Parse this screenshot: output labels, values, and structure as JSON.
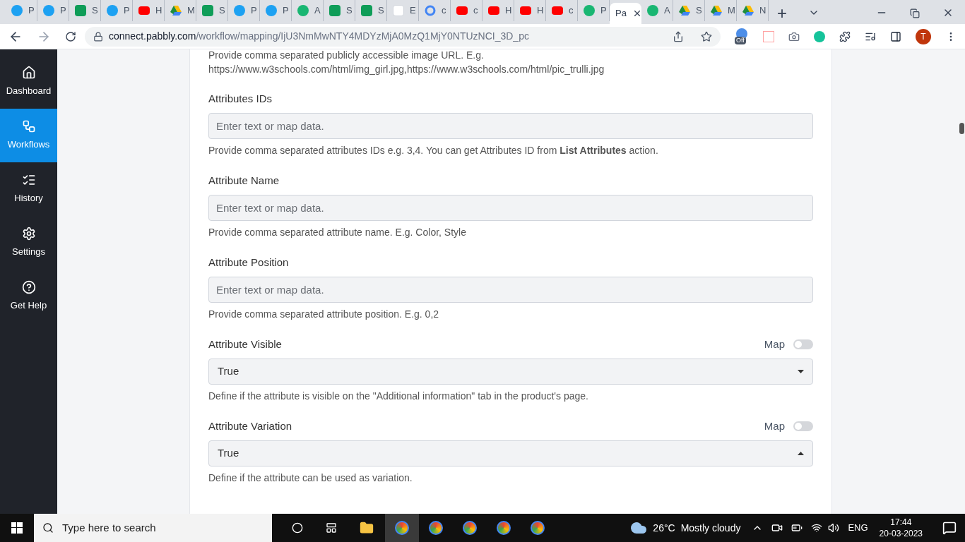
{
  "browser": {
    "tabs": [
      {
        "kind": "t",
        "label": "P",
        "selected": false
      },
      {
        "kind": "t",
        "label": "P",
        "selected": false
      },
      {
        "kind": "sheet",
        "label": "S",
        "selected": false
      },
      {
        "kind": "t",
        "label": "P",
        "selected": false
      },
      {
        "kind": "yt",
        "label": "H",
        "selected": false
      },
      {
        "kind": "drive",
        "label": "M",
        "selected": false
      },
      {
        "kind": "sheet",
        "label": "S",
        "selected": false
      },
      {
        "kind": "t",
        "label": "P",
        "selected": false
      },
      {
        "kind": "t",
        "label": "P",
        "selected": false
      },
      {
        "kind": "pabbly",
        "label": "A",
        "selected": false
      },
      {
        "kind": "sheet",
        "label": "S",
        "selected": false
      },
      {
        "kind": "sheet",
        "label": "S",
        "selected": false
      },
      {
        "kind": "amazon",
        "label": "E",
        "selected": false
      },
      {
        "kind": "google",
        "label": "c",
        "selected": false
      },
      {
        "kind": "yt",
        "label": "c",
        "selected": false
      },
      {
        "kind": "yt",
        "label": "H",
        "selected": false
      },
      {
        "kind": "yt",
        "label": "H",
        "selected": false
      },
      {
        "kind": "yt",
        "label": "c",
        "selected": false
      },
      {
        "kind": "pabbly",
        "label": "P",
        "selected": false
      },
      {
        "kind": "none",
        "label": "Pa",
        "selected": true
      },
      {
        "kind": "pabbly",
        "label": "A",
        "selected": false
      },
      {
        "kind": "drive",
        "label": "S",
        "selected": false
      },
      {
        "kind": "drive",
        "label": "M",
        "selected": false
      },
      {
        "kind": "drive",
        "label": "N",
        "selected": false
      }
    ],
    "new_tab": "+",
    "url_host": "connect.pabbly.com",
    "url_path": "/workflow/mapping/IjU3NmMwNTY4MDYzMjA0MzQ1MjY0NTUzNCI_3D_pc",
    "extension_badge": "Off",
    "profile": "T"
  },
  "sidebar": [
    {
      "kind": "home",
      "label": "Dashboard",
      "selected": false
    },
    {
      "kind": "flow",
      "label": "Workflows",
      "selected": true
    },
    {
      "kind": "list",
      "label": "History",
      "selected": false
    },
    {
      "kind": "gear",
      "label": "Settings",
      "selected": false
    },
    {
      "kind": "help",
      "label": "Get Help",
      "selected": false
    }
  ],
  "intro": [
    "Provide comma separated publicly accessible image URL. E.g.",
    "https://www.w3schools.com/html/img_girl.jpg,https://www.w3schools.com/html/pic_trulli.jpg"
  ],
  "fields": [
    {
      "kind": "text",
      "label": "Attributes IDs",
      "placeholder": "Enter text or map data.",
      "help": "Provide comma separated attributes IDs e.g. 3,4. You can get Attributes ID from **List Attributes** action."
    },
    {
      "kind": "text",
      "label": "Attribute Name",
      "placeholder": "Enter text or map data.",
      "help": "Provide comma separated attribute name. E.g. Color, Style"
    },
    {
      "kind": "text",
      "label": "Attribute Position",
      "placeholder": "Enter text or map data.",
      "help": "Provide comma separated attribute position. E.g. 0,2"
    },
    {
      "kind": "select",
      "label": "Attribute Visible",
      "map_label": "Map",
      "map_on": false,
      "value": "True",
      "expanded": false,
      "help": "Define if the attribute is visible on the \"Additional information\" tab in the product's page."
    },
    {
      "kind": "select",
      "label": "Attribute Variation",
      "map_label": "Map",
      "map_on": false,
      "value": "True",
      "expanded": true,
      "help": "Define if the attribute can be used as variation."
    }
  ],
  "taskbar": {
    "search_placeholder": "Type here to search",
    "temperature": "26°C",
    "weather": "Mostly cloudy",
    "language": "ENG",
    "time": "17:44",
    "date": "20-03-2023"
  }
}
